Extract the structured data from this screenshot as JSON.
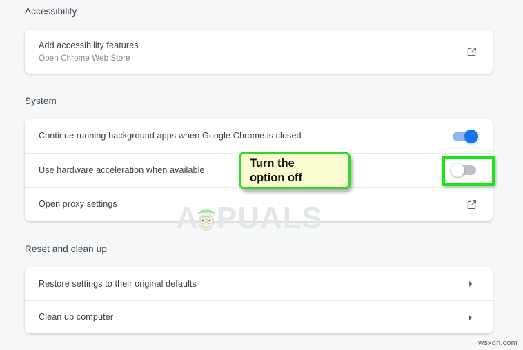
{
  "sections": [
    {
      "title": "Accessibility",
      "rows": [
        {
          "primary": "Add accessibility features",
          "secondary": "Open Chrome Web Store",
          "control": "external-link-icon"
        }
      ]
    },
    {
      "title": "System",
      "rows": [
        {
          "primary": "Continue running background apps when Google Chrome is closed",
          "control": "toggle",
          "toggle_state": "on"
        },
        {
          "primary": "Use hardware acceleration when available",
          "control": "toggle",
          "toggle_state": "off"
        },
        {
          "primary": "Open proxy settings",
          "control": "external-link-icon"
        }
      ]
    },
    {
      "title": "Reset and clean up",
      "rows": [
        {
          "primary": "Restore settings to their original defaults",
          "control": "chevron-right-icon"
        },
        {
          "primary": "Clean up computer",
          "control": "chevron-right-icon"
        }
      ]
    }
  ],
  "annotation": {
    "callout_line1": "Turn the",
    "callout_line2": "option off",
    "callout_fill": "#fbfbd0",
    "callout_border": "#2ed62e",
    "highlight_border": "#13e813"
  },
  "watermark": {
    "letter_first": "A",
    "letters_rest": "PUALS"
  },
  "footer": {
    "source": "wsxdn.com"
  },
  "colors": {
    "page_background": "#f6f7f9",
    "card_background": "#ffffff",
    "primary_text": "#3c4043",
    "secondary_text": "#80868b",
    "toggle_on_track": "#8fb6f4",
    "toggle_on_knob": "#1a73e8",
    "toggle_off_track": "#bdc1c6",
    "icon": "#5f6368"
  }
}
